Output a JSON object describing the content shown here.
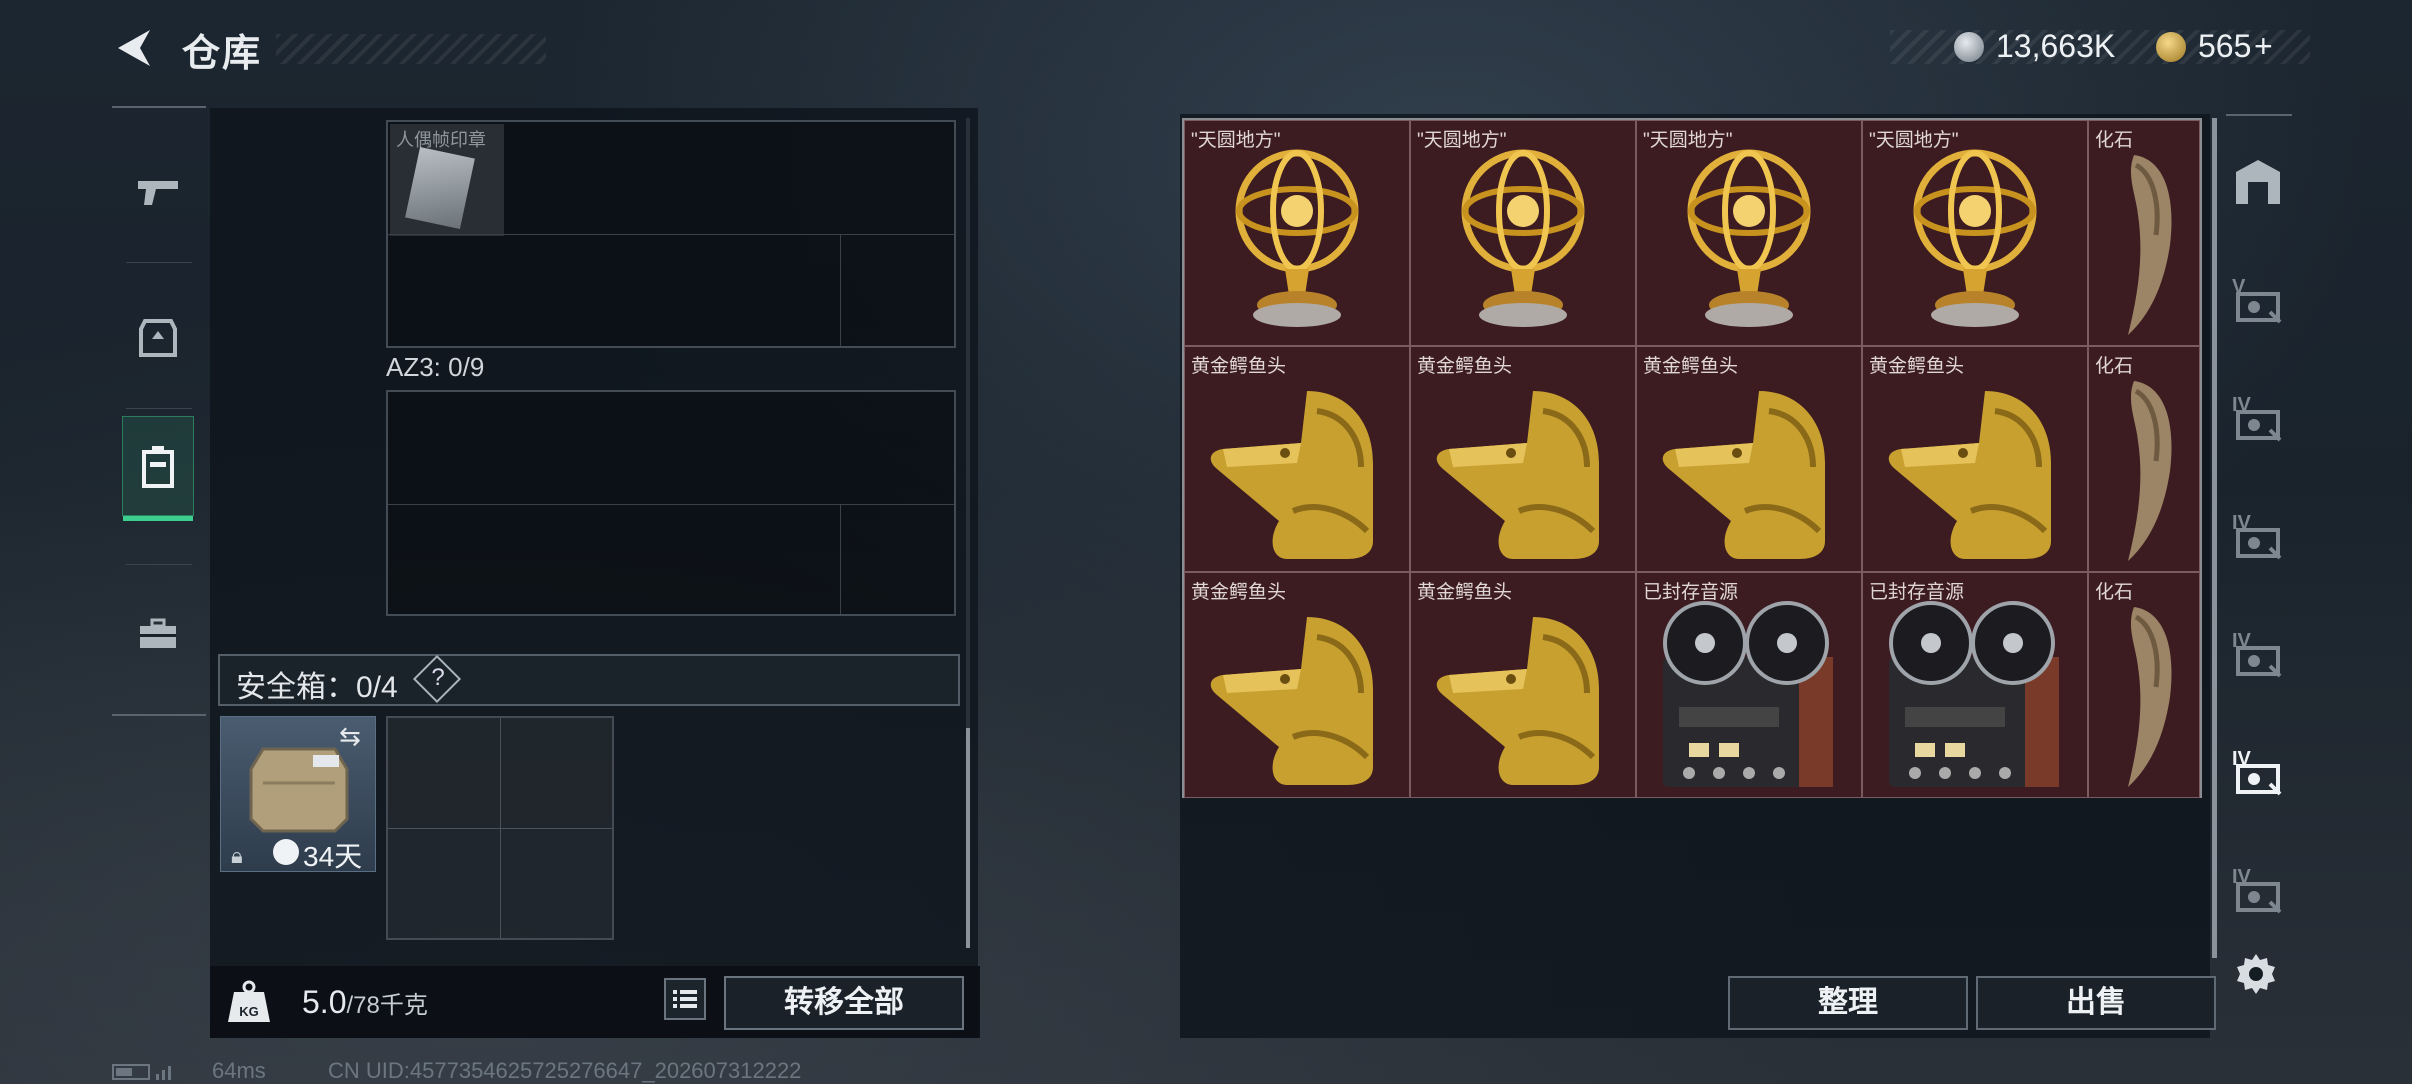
{
  "header": {
    "title": "仓库"
  },
  "currency": {
    "coins": "13,663K",
    "gold": "565",
    "plus": "+"
  },
  "left": {
    "slot_item_label": "人偶帧印章",
    "az3_label": "AZ3: 0/9",
    "safe_box_label": "安全箱：0/4",
    "help": "?",
    "case_days": "34天",
    "weight_value": "5.0",
    "weight_max": "/78千克",
    "move_all": "转移全部"
  },
  "right": {
    "items": [
      {
        "name": "\"天圆地方\"",
        "type": "armillary"
      },
      {
        "name": "\"天圆地方\"",
        "type": "armillary"
      },
      {
        "name": "\"天圆地方\"",
        "type": "armillary"
      },
      {
        "name": "\"天圆地方\"",
        "type": "armillary"
      },
      {
        "name": "化石",
        "type": "fossil"
      },
      {
        "name": "黄金鳄鱼头",
        "type": "croc"
      },
      {
        "name": "黄金鳄鱼头",
        "type": "croc"
      },
      {
        "name": "黄金鳄鱼头",
        "type": "croc"
      },
      {
        "name": "黄金鳄鱼头",
        "type": "croc"
      },
      {
        "name": "化石",
        "type": "fossil"
      },
      {
        "name": "黄金鳄鱼头",
        "type": "croc"
      },
      {
        "name": "黄金鳄鱼头",
        "type": "croc"
      },
      {
        "name": "已封存音源",
        "type": "reel"
      },
      {
        "name": "已封存音源",
        "type": "reel"
      },
      {
        "name": "化石",
        "type": "fossil"
      }
    ],
    "sort_btn": "整理",
    "sell_btn": "出售",
    "side_tabs": [
      "V",
      "IV",
      "IV",
      "IV",
      "IV",
      "IV"
    ]
  },
  "status": {
    "ping": "64ms",
    "uid": "CN UID:4577354625725276647_202607312222"
  },
  "colors": {
    "accent": "#3ccf8e",
    "item_bg": "#3c1c20",
    "gold": "#d4a72c"
  }
}
